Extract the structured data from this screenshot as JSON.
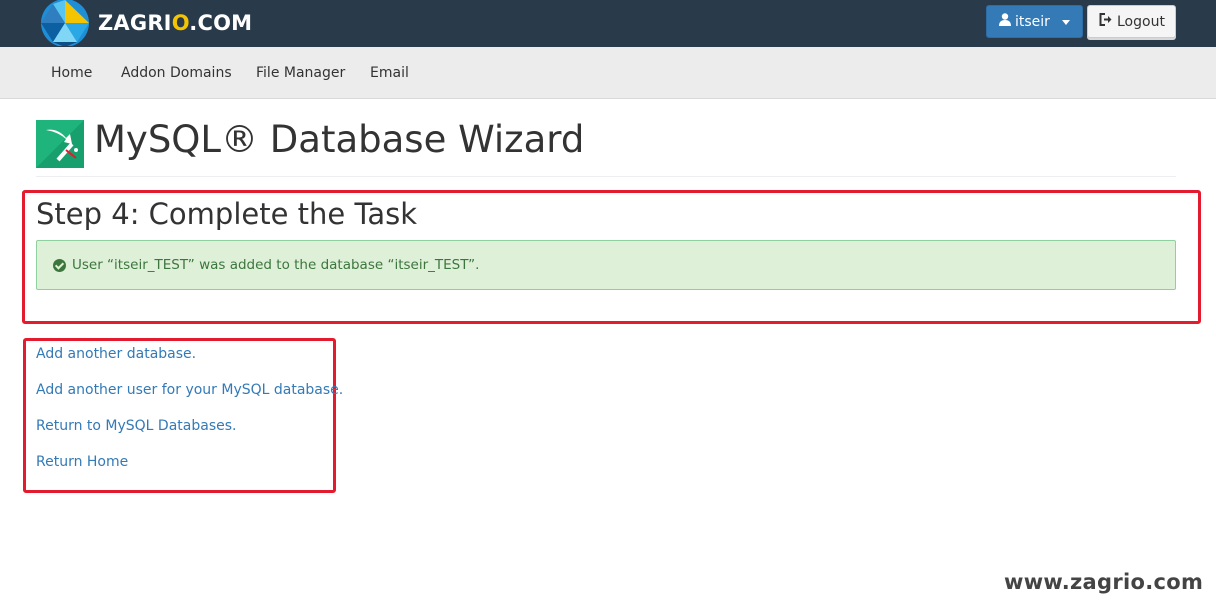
{
  "header": {
    "logo_text_pre": "ZAGRI",
    "logo_text_accent": "O",
    "logo_text_post": ".COM",
    "user_menu_label": "itseir",
    "logout_label": "Logout"
  },
  "nav": {
    "items": [
      {
        "label": "Home"
      },
      {
        "label": "Addon Domains"
      },
      {
        "label": "File Manager"
      },
      {
        "label": "Email"
      }
    ]
  },
  "page": {
    "title": "MySQL® Database Wizard"
  },
  "step": {
    "heading": "Step 4: Complete the Task",
    "alert_message": "User “itseir_TEST” was added to the database “itseir_TEST”."
  },
  "links": [
    {
      "label": "Add another database."
    },
    {
      "label": "Add another user for your MySQL database."
    },
    {
      "label": "Return to MySQL Databases."
    },
    {
      "label": "Return Home"
    }
  ],
  "watermark": "www.zagrio.com",
  "colors": {
    "header_bg": "#293a4a",
    "primary": "#337ab7",
    "success_bg": "#dff0d8",
    "success_text": "#3c763d",
    "highlight": "#e41b2f"
  }
}
